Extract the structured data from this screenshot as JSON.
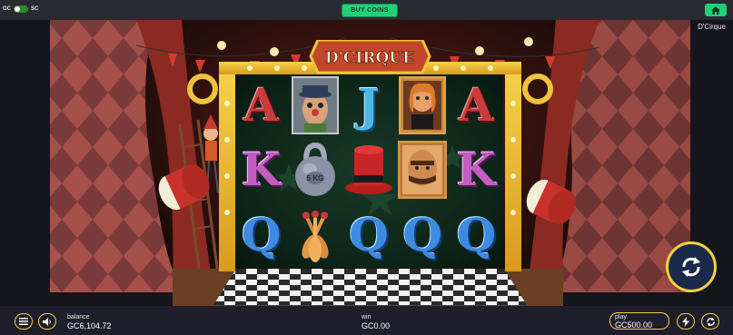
{
  "topbar": {
    "toggle_left": "GC",
    "toggle_right": "SC",
    "buy_coins_label": "BUY COINS",
    "home_icon": "home-icon"
  },
  "game": {
    "title": "D'Cirque",
    "logo_text": "D'CIRQUE"
  },
  "reels": [
    [
      "A",
      "portrait-clown-man",
      "J",
      "portrait-lady",
      "A"
    ],
    [
      "K",
      "kettlebell",
      "top-hat",
      "portrait-strongman",
      "K"
    ],
    [
      "Q",
      "juggling-pins",
      "Q",
      "Q",
      "Q"
    ]
  ],
  "kettlebell_label": "5 KG",
  "bottombar": {
    "menu_icon": "menu-icon",
    "sound_icon": "speaker-icon",
    "balance_label": "balance",
    "balance_value": "GC6,104.72",
    "win_label": "win",
    "win_value": "GC0.00",
    "play_label": "play",
    "play_value": "GC500.00",
    "turbo_icon": "lightning-icon",
    "autoplay_icon": "autoplay-icon"
  },
  "spin_icon": "spin-arrows-icon",
  "colors": {
    "accent_green": "#22d07a",
    "accent_yellow": "#f4d23c",
    "bar_bg": "#1e1e2c"
  }
}
